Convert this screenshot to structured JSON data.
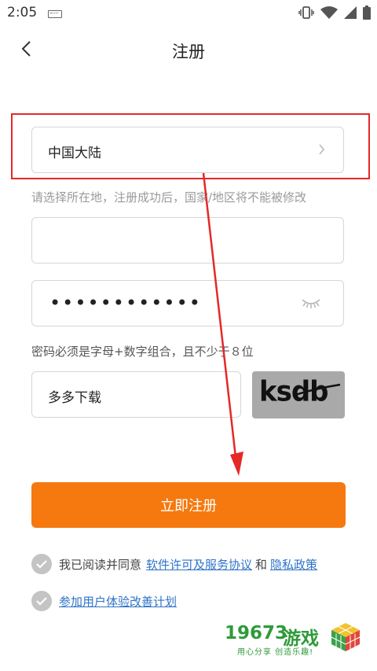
{
  "status_bar": {
    "time": "2:05"
  },
  "header": {
    "title": "注册"
  },
  "form": {
    "region": {
      "value": "中国大陆",
      "hint": "请选择所在地，注册成功后，国家/地区将不能被修改"
    },
    "phone": {
      "value": ""
    },
    "password": {
      "masked_value": "••••••••••••",
      "hint": "密码必须是字母+数字组合，且不少于８位"
    },
    "captcha": {
      "value": "多多下载",
      "image_text": "ksdb"
    },
    "submit_label": "立即注册"
  },
  "agreements": {
    "row1": {
      "text": "我已阅读并同意",
      "link1": "软件许可及服务协议",
      "and": "和",
      "link2": "隐私政策"
    },
    "row2": {
      "link": "参加用户体验改善计划"
    }
  },
  "watermark": {
    "number": "19673",
    "name": "游戏",
    "slogan": "用心分享 创造乐趣!"
  },
  "colors": {
    "accent": "#f5790e",
    "link": "#2f73c8",
    "annotation": "#e52828"
  }
}
